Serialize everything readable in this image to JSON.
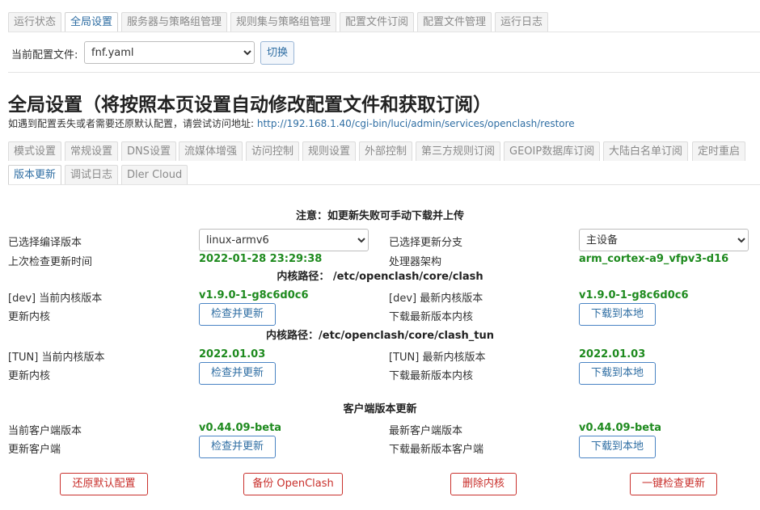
{
  "top_tabs": [
    "运行状态",
    "全局设置",
    "服务器与策略组管理",
    "规则集与策略组管理",
    "配置文件订阅",
    "配置文件管理",
    "运行日志"
  ],
  "config": {
    "label": "当前配置文件:",
    "value": "fnf.yaml",
    "switch_label": "切换"
  },
  "page": {
    "title": "全局设置（将按照本页设置自动修改配置文件和获取订阅）",
    "restore_hint": "如遇到配置丢失或者需要还原默认配置，请尝试访问地址:",
    "restore_url": "http://192.168.1.40/cgi-bin/luci/admin/services/openclash/restore"
  },
  "sub_tabs_row1": [
    "模式设置",
    "常规设置",
    "DNS设置",
    "流媒体增强",
    "访问控制",
    "规则设置",
    "外部控制",
    "第三方规则订阅",
    "GEOIP数据库订阅",
    "大陆白名单订阅",
    "定时重启"
  ],
  "sub_tabs_row2": [
    "版本更新",
    "调试日志",
    "Dler Cloud"
  ],
  "update": {
    "notice": "注意：如更新失败可手动下载并上传",
    "compile_version_label": "已选择编译版本",
    "compile_version_value": "linux-armv6",
    "branch_label": "已选择更新分支",
    "branch_value": "主设备",
    "last_check_label": "上次检查更新时间",
    "last_check_value": "2022-01-28 23:29:38",
    "arch_label": "处理器架构",
    "arch_value": "arm_cortex-a9_vfpv3-d16",
    "core_path": "内核路径： /etc/openclash/core/clash",
    "dev_current_label": "[dev] 当前内核版本",
    "dev_current_value": "v1.9.0-1-g8c6d0c6",
    "dev_latest_label": "[dev] 最新内核版本",
    "dev_latest_value": "v1.9.0-1-g8c6d0c6",
    "update_core_label": "更新内核",
    "download_core_label": "下载最新版本内核",
    "check_update_button": "检查并更新",
    "download_local_button": "下载到本地",
    "tun_path": "内核路径：/etc/openclash/core/clash_tun",
    "tun_current_label": "[TUN] 当前内核版本",
    "tun_current_value": "2022.01.03",
    "tun_latest_label": "[TUN] 最新内核版本",
    "tun_latest_value": "2022.01.03",
    "client_title": "客户端版本更新",
    "client_current_label": "当前客户端版本",
    "client_current_value": "v0.44.09-beta",
    "client_latest_label": "最新客户端版本",
    "client_latest_value": "v0.44.09-beta",
    "update_client_label": "更新客户端",
    "download_client_label": "下载最新版本客户端"
  },
  "bottom_buttons": [
    "还原默认配置",
    "备份 OpenClash",
    "删除内核",
    "一键检查更新"
  ]
}
